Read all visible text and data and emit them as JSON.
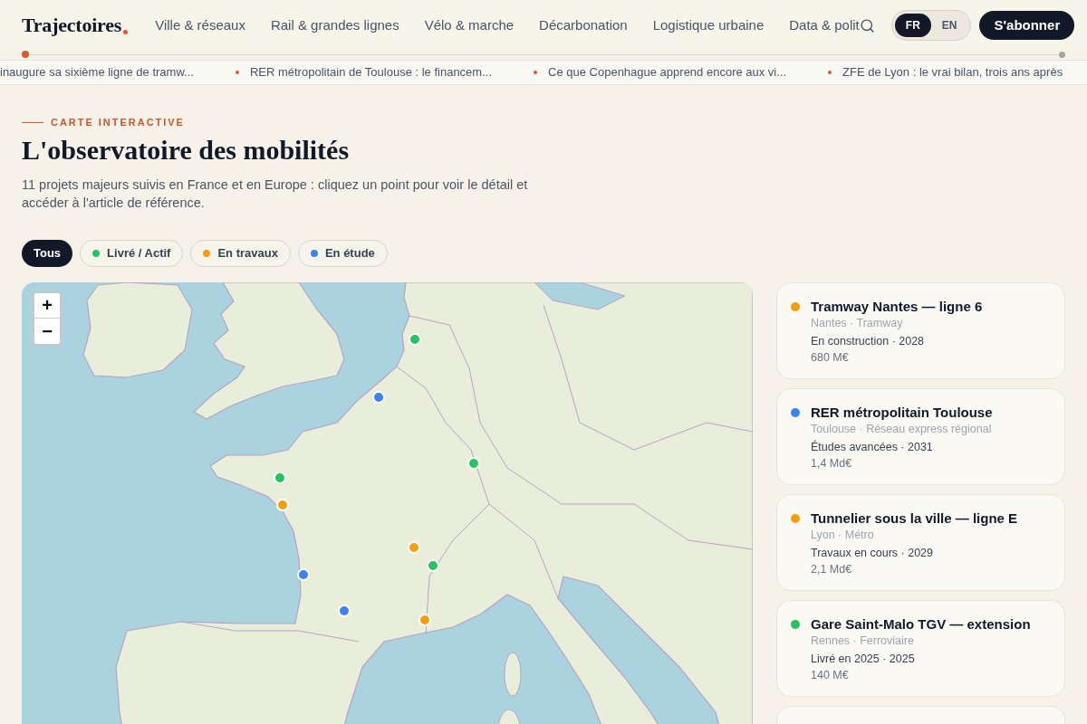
{
  "header": {
    "logo": "Trajectoires",
    "nav": [
      "Ville & réseaux",
      "Rail & grandes lignes",
      "Vélo & marche",
      "Décarbonation",
      "Logistique urbaine",
      "Data & polit"
    ],
    "languages": [
      {
        "label": "FR",
        "selected": true
      },
      {
        "label": "EN",
        "selected": false
      }
    ],
    "subscribe": "S'abonner"
  },
  "reading_progress": {
    "level": 0
  },
  "ticker": [
    "inaugure sa sixième ligne de tramw...",
    "RER métropolitain de Toulouse : le financem...",
    "Ce que Copenhague apprend encore aux vi...",
    "ZFE de Lyon : le vrai bilan, trois ans après"
  ],
  "intro": {
    "eyebrow": "CARTE INTERACTIVE",
    "title": "L'observatoire des mobilités",
    "description": "11 projets majeurs suivis en France et en Europe : cliquez un point pour voir le détail et accéder à l'article de référence."
  },
  "filters": [
    {
      "label": "Tous",
      "selected": true
    },
    {
      "label": "Livré / Actif",
      "selected": false,
      "color": "#22c55e"
    },
    {
      "label": "En travaux",
      "selected": false,
      "color": "#f59e0b"
    },
    {
      "label": "En étude",
      "selected": false,
      "color": "#3b82f6"
    }
  ],
  "map": {
    "zoom_controls": [
      "+",
      "−"
    ],
    "pins": [
      {
        "color": "#22c55e"
      },
      {
        "color": "#3b82f6"
      },
      {
        "color": "#22c55e"
      },
      {
        "color": "#22c55e"
      },
      {
        "color": "#f59e0b"
      },
      {
        "color": "#f59e0b"
      },
      {
        "color": "#22c55e"
      },
      {
        "color": "#3b82f6"
      },
      {
        "color": "#3b82f6"
      },
      {
        "color": "#f59e0b"
      }
    ]
  },
  "projects": [
    {
      "title": "Tramway Nantes — ligne 6",
      "color": "#f59e0b",
      "location": "Nantes · Tramway",
      "status": "En construction · 2028",
      "budget": "680 M€"
    },
    {
      "title": "RER métropolitain Toulouse",
      "color": "#3b82f6",
      "location": "Toulouse · Réseau express régional",
      "status": "Études avancées · 2031",
      "budget": "1,4 Md€"
    },
    {
      "title": "Tunnelier sous la ville — ligne E",
      "color": "#f59e0b",
      "location": "Lyon · Métro",
      "status": "Travaux en cours · 2029",
      "budget": "2,1 Md€"
    },
    {
      "title": "Gare Saint-Malo TGV — extension",
      "color": "#22c55e",
      "location": "Rennes · Ferroviaire",
      "status": "Livré en 2025 · 2025",
      "budget": "140 M€"
    }
  ]
}
